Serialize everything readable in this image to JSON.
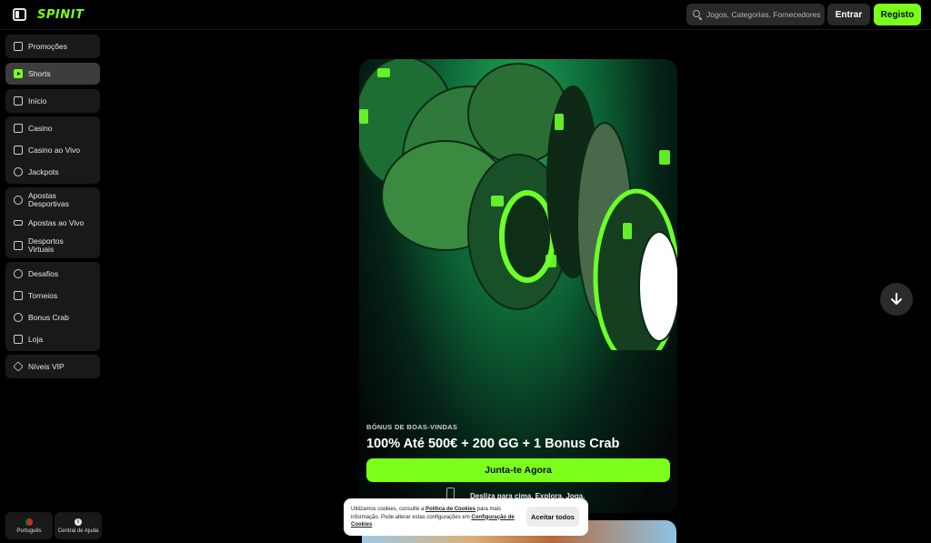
{
  "header": {
    "logo": "SPINIT",
    "search_placeholder": "Jogos, Categorias, Fornecedores",
    "login_label": "Entrar",
    "register_label": "Registo"
  },
  "sidebar": {
    "groups": [
      [
        {
          "label": "Promoções",
          "icon": "gift-icon"
        }
      ],
      [
        {
          "label": "Shorts",
          "icon": "play-icon",
          "active": true
        }
      ],
      [
        {
          "label": "Início",
          "icon": "home-icon"
        }
      ],
      [
        {
          "label": "Casino",
          "icon": "slot-machine-icon"
        },
        {
          "label": "Casino ao Vivo",
          "icon": "live-casino-icon"
        },
        {
          "label": "Jackpots",
          "icon": "jackpot-icon"
        }
      ],
      [
        {
          "label": "Apostas Desportivas",
          "icon": "soccer-ball-icon"
        },
        {
          "label": "Apostas ao Vivo",
          "icon": "live-bets-icon"
        },
        {
          "label": "Desportos Virtuais",
          "icon": "monitor-icon"
        }
      ],
      [
        {
          "label": "Desafios",
          "icon": "challenge-icon"
        },
        {
          "label": "Torneios",
          "icon": "trophy-icon"
        },
        {
          "label": "Bonus Crab",
          "icon": "crab-icon"
        },
        {
          "label": "Loja",
          "icon": "shop-bag-icon"
        }
      ],
      [
        {
          "label": "Níveis VIP",
          "icon": "diamond-icon"
        }
      ]
    ],
    "footer": {
      "language_label": "Português",
      "help_label": "Central de Ajuda"
    }
  },
  "promo": {
    "label": "BÓNUS DE BOAS-VINDAS",
    "title": "100% Até 500€ + 200 GG + 1 Bonus Crab",
    "cta_label": "Junta-te Agora",
    "hint": "Desliza para cima. Explora. Joga."
  },
  "cookie": {
    "text_1": "Utilizamos cookies, consulte a ",
    "link_1": "Política de Cookies",
    "text_2": " para mais informação. Pode alterar estas configurações em ",
    "link_2": "Configuração de Cookies",
    "accept_label": "Aceitar todos"
  },
  "colors": {
    "accent": "#7cff1a",
    "background": "#000000",
    "panel": "#191919"
  }
}
